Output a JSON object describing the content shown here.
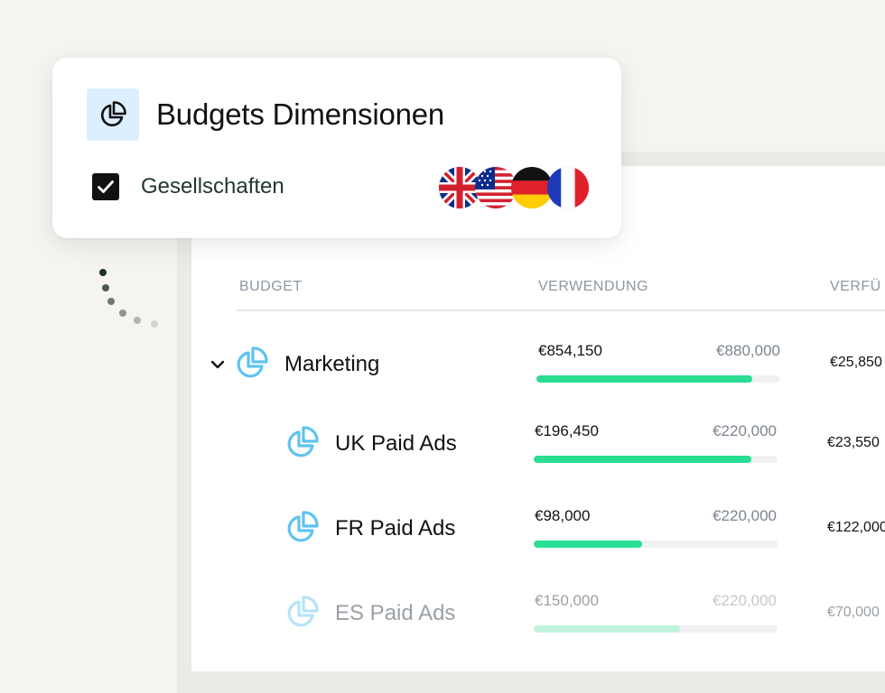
{
  "card": {
    "title": "Budgets Dimensionen",
    "title_icon": "pie-chart-icon",
    "checkbox_label": "Gesellschaften",
    "checkbox_checked": true,
    "flags": [
      "uk-flag-icon",
      "us-flag-icon",
      "germany-flag-icon",
      "france-flag-icon"
    ]
  },
  "table": {
    "columns": {
      "budget": "BUDGET",
      "usage": "VERWENDUNG",
      "available": "VERFÜ"
    },
    "rows": [
      {
        "name": "Marketing",
        "used": "€854,150",
        "total": "€880,000",
        "progress": 0.885,
        "available": "€25,850",
        "expanded": true
      },
      {
        "name": "UK Paid Ads",
        "used": "€196,450",
        "total": "€220,000",
        "progress": 0.893,
        "available": "€23,550"
      },
      {
        "name": "FR Paid Ads",
        "used": "€98,000",
        "total": "€220,000",
        "progress": 0.445,
        "available": "€122,000"
      },
      {
        "name": "ES Paid Ads",
        "used": "€150,000",
        "total": "€220,000",
        "progress": 0.6,
        "available": "€70,000"
      }
    ]
  },
  "colors": {
    "accent_progress": "#29de93",
    "icon_blue": "#5ec3f2",
    "icon_bg": "#dcefff"
  }
}
